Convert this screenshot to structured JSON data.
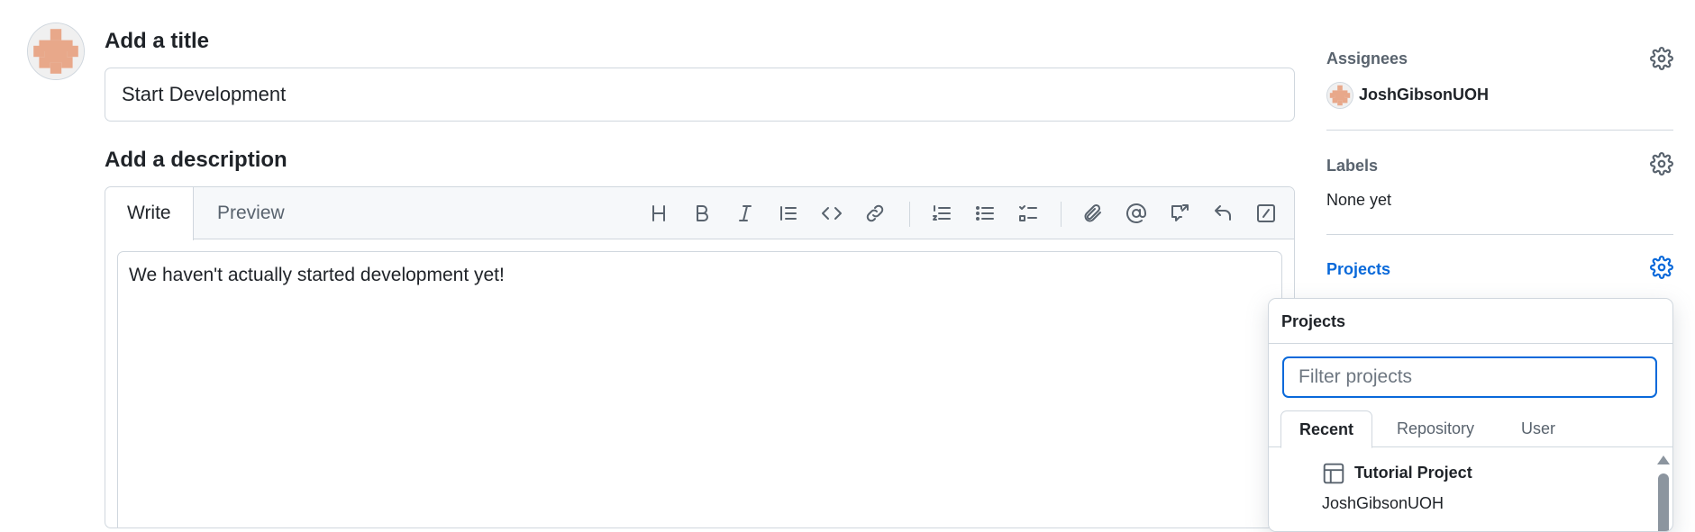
{
  "issue": {
    "title_heading": "Add a title",
    "title_value": "Start Development",
    "description_heading": "Add a description",
    "description_text": "We haven't actually started development yet!"
  },
  "editor": {
    "tabs": [
      {
        "label": "Write",
        "active": true
      },
      {
        "label": "Preview",
        "active": false
      }
    ],
    "toolbar_icons": [
      "heading-icon",
      "bold-icon",
      "italic-icon",
      "quote-icon",
      "code-icon",
      "link-icon",
      "numbered-list-icon",
      "unordered-list-icon",
      "task-list-icon",
      "attach-icon",
      "mention-icon",
      "cross-reference-icon",
      "saved-replies-icon",
      "slash-commands-icon"
    ]
  },
  "sidebar": {
    "assignees": {
      "label": "Assignees",
      "user": "JoshGibsonUOH"
    },
    "labels": {
      "label": "Labels",
      "value": "None yet"
    },
    "projects": {
      "label": "Projects"
    }
  },
  "projects_popover": {
    "title": "Projects",
    "filter_placeholder": "Filter projects",
    "tabs": [
      {
        "label": "Recent",
        "active": true
      },
      {
        "label": "Repository",
        "active": false
      },
      {
        "label": "User",
        "active": false
      }
    ],
    "items": [
      {
        "name": "Tutorial Project",
        "owner": "JoshGibsonUOH",
        "icon": "table-icon"
      }
    ]
  },
  "colors": {
    "accent": "#0969da",
    "border": "#d0d7de",
    "muted_text": "#59636e",
    "avatar_pink": "#e8a88a"
  }
}
